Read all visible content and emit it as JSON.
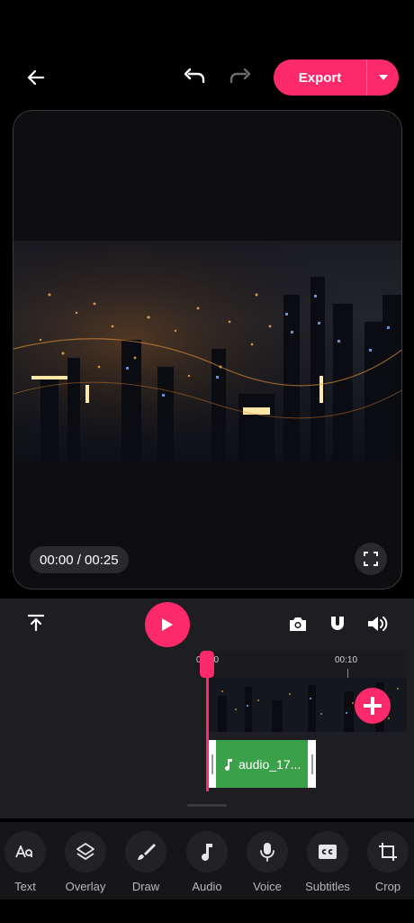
{
  "topbar": {
    "back_icon": "arrow-left-icon",
    "undo_icon": "undo-icon",
    "redo_icon": "redo-icon",
    "export_label": "Export",
    "export_caret_icon": "caret-down-icon",
    "accent_color": "#fc2a6a"
  },
  "preview": {
    "time_display": "00:00 / 00:25",
    "fullscreen_icon": "fullscreen-icon"
  },
  "controls": {
    "upload_icon": "upload-top-icon",
    "play_icon": "play-icon",
    "snapshot_icon": "camera-icon",
    "magnet_icon": "magnet-icon",
    "volume_icon": "volume-icon"
  },
  "timeline": {
    "tick_labels": [
      "00:00",
      "00:10"
    ],
    "playhead_fraction": 0.0,
    "audio_clip_label": "audio_17...",
    "add_clip_icon": "plus-icon",
    "audio_color": "#3aa14a"
  },
  "toolbar": {
    "items": [
      {
        "label": "Text",
        "icon": "text-aa-icon"
      },
      {
        "label": "Overlay",
        "icon": "layers-icon"
      },
      {
        "label": "Draw",
        "icon": "brush-icon"
      },
      {
        "label": "Audio",
        "icon": "music-note-icon"
      },
      {
        "label": "Voice",
        "icon": "microphone-icon"
      },
      {
        "label": "Subtitles",
        "icon": "cc-icon"
      },
      {
        "label": "Crop",
        "icon": "crop-icon"
      }
    ]
  }
}
